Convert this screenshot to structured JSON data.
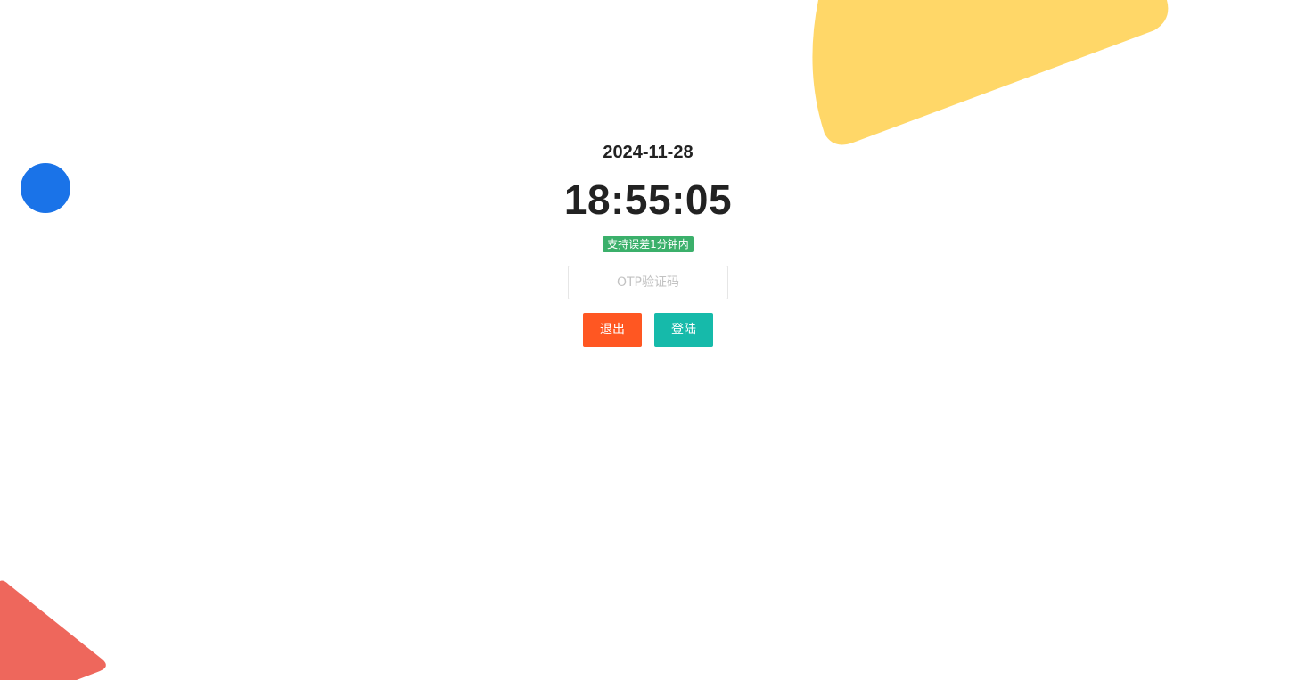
{
  "date": "2024-11-28",
  "time": "18:55:05",
  "badge": "支持误差1分钟内",
  "otp": {
    "placeholder": "OTP验证码",
    "value": ""
  },
  "buttons": {
    "logout": "退出",
    "login": "登陆"
  },
  "colors": {
    "badge": "#3bb06b",
    "logout": "#ff5722",
    "login": "#16baaa",
    "deco_yellow": "#ffd768",
    "deco_blue": "#1a73e8",
    "deco_red": "#ee675c"
  }
}
